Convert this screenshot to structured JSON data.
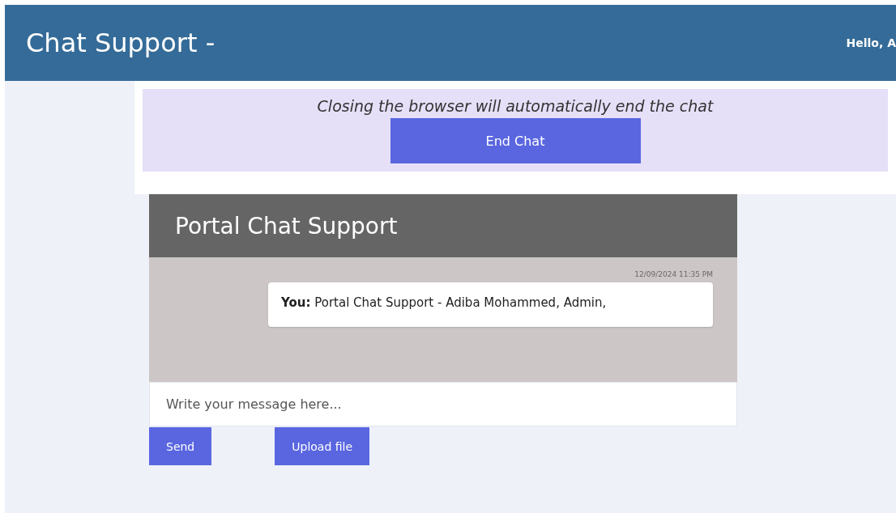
{
  "header": {
    "title": "Chat Support -",
    "greeting": "Hello, A"
  },
  "notice": {
    "text": "Closing the browser will automatically end the chat",
    "button": "End Chat"
  },
  "chat": {
    "title": "Portal Chat Support",
    "messages": [
      {
        "time": "12/09/2024 11:35 PM",
        "text": "**You:** Portal Chat Support - Adiba Mohammed, Admin,"
      }
    ],
    "input": {
      "placeholder": "Write your message here..."
    },
    "buttons": [
      "Send",
      "Upload file"
    ]
  }
}
